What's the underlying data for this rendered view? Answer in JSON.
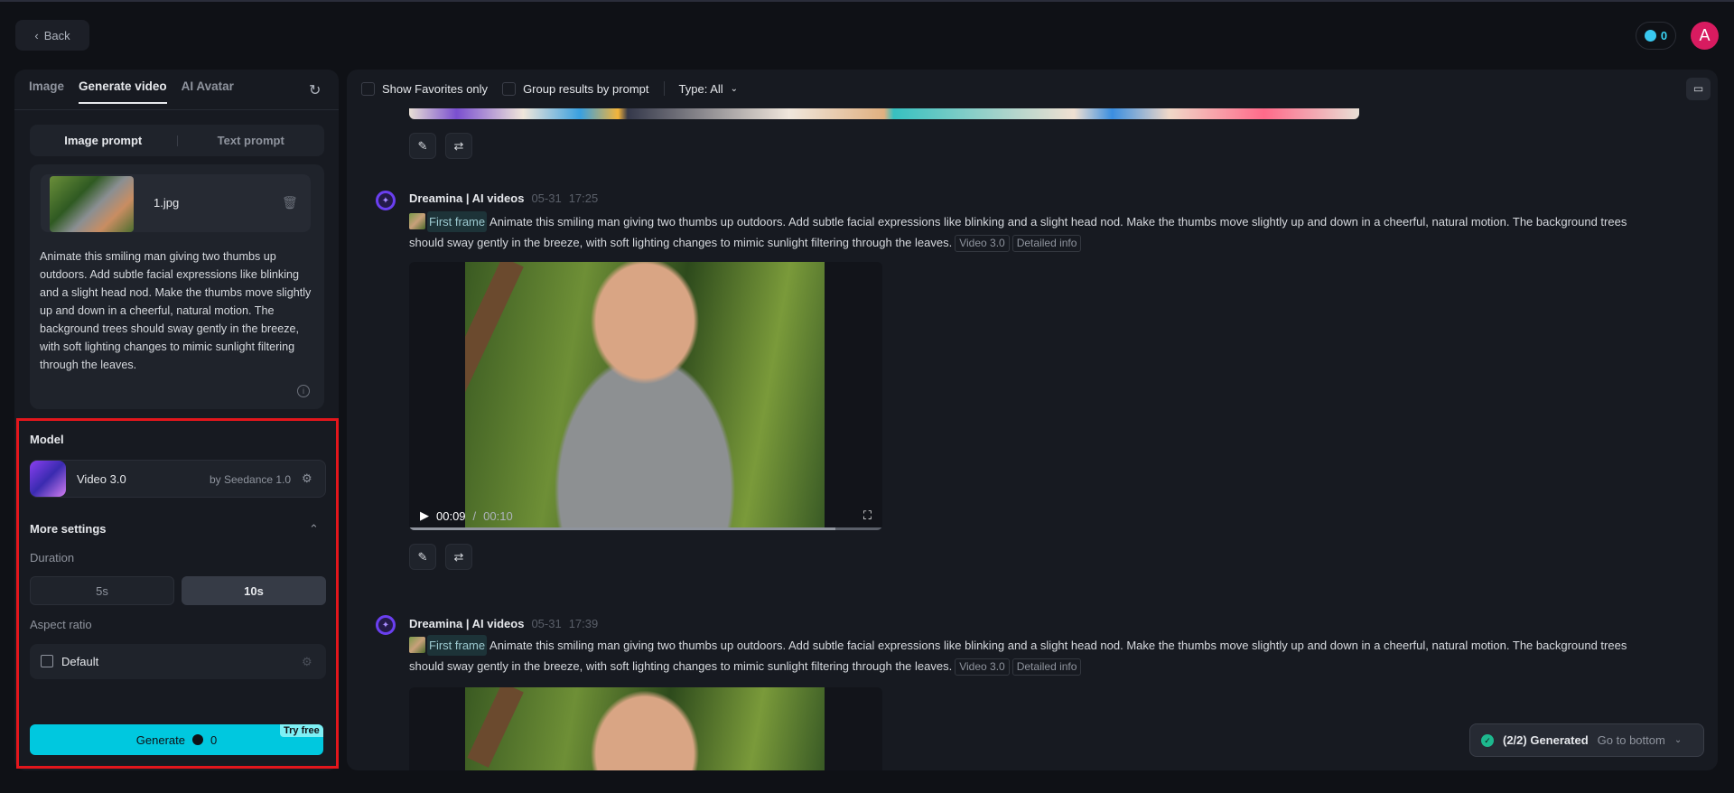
{
  "header": {
    "back_label": "Back",
    "credits": "0",
    "user_initial": "A"
  },
  "left_panel": {
    "tabs": [
      {
        "label": "Image"
      },
      {
        "label": "Generate video",
        "active": true
      },
      {
        "label": "AI Avatar"
      }
    ],
    "prompt_modes": [
      {
        "label": "Image prompt",
        "active": true
      },
      {
        "label": "Text prompt"
      }
    ],
    "uploaded_file": "1.jpg",
    "prompt_text": "Animate this smiling man giving two thumbs up outdoors. Add subtle facial expressions like blinking and a slight head nod. Make the thumbs move slightly up and down in a cheerful, natural motion. The background trees should sway gently in the breeze, with soft lighting changes to mimic sunlight filtering through the leaves.",
    "model_label": "Model",
    "model_name": "Video 3.0",
    "model_by": "by Seedance 1.0",
    "more_settings_label": "More settings",
    "duration_label": "Duration",
    "durations": [
      {
        "label": "5s"
      },
      {
        "label": "10s",
        "selected": true
      }
    ],
    "aspect_label": "Aspect ratio",
    "aspect_value": "Default",
    "generate_label": "Generate",
    "generate_cost": "0",
    "try_free": "Try free"
  },
  "toolbar": {
    "favorites_label": "Show Favorites only",
    "group_label": "Group results by prompt",
    "type_label": "Type: All"
  },
  "entries": [
    {
      "author": "Dreamina | AI videos",
      "date": "05-31",
      "time": "17:25",
      "first_frame": "First frame",
      "text": "Animate this smiling man giving two thumbs up outdoors. Add subtle facial expressions like blinking and a slight head nod. Make the thumbs move slightly up and down in a cheerful, natural motion. The background trees should sway gently in the breeze, with soft lighting changes to mimic sunlight filtering through the leaves.",
      "model_tag": "Video 3.0",
      "info_tag": "Detailed info",
      "current_time": "00:09",
      "duration": "00:10",
      "progress": 0.9
    },
    {
      "author": "Dreamina | AI videos",
      "date": "05-31",
      "time": "17:39",
      "first_frame": "First frame",
      "text": "Animate this smiling man giving two thumbs up outdoors. Add subtle facial expressions like blinking and a slight head nod. Make the thumbs move slightly up and down in a cheerful, natural motion. The background trees should sway gently in the breeze, with soft lighting changes to mimic sunlight filtering through the leaves.",
      "model_tag": "Video 3.0",
      "info_tag": "Detailed info"
    }
  ],
  "toast": {
    "status": "(2/2) Generated",
    "action": "Go to bottom"
  },
  "colors": {
    "accent": "#00c8df",
    "highlight_box": "#e3161c",
    "avatar": "#d81b60"
  }
}
